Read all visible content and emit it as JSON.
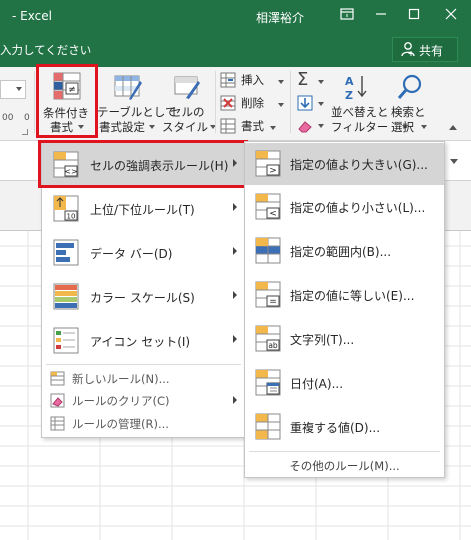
{
  "titlebar": {
    "app": "-  Excel",
    "user": "相澤裕介"
  },
  "tellme": {
    "text": "入力してください",
    "share": "共有"
  },
  "ribbon": {
    "num_decimal_1": "00",
    "num_decimal_2": "0",
    "conditional_format": {
      "line1": "条件付き",
      "line2": "書式"
    },
    "table_format": {
      "line1": "テーブルとして",
      "line2": "書式設定"
    },
    "cell_style": {
      "line1": "セルの",
      "line2": "スタイル"
    },
    "insert": "挿入",
    "delete": "削除",
    "format": "書式",
    "sort_filter": {
      "line1": "並べ替えと",
      "line2": "フィルター"
    },
    "find_select": {
      "line1": "検索と",
      "line2": "選択"
    }
  },
  "main_menu": {
    "items": [
      {
        "label": "セルの強調表示ルール(H)",
        "icon": "highlight-rules-icon"
      },
      {
        "label": "上位/下位ルール(T)",
        "icon": "top-bottom-icon"
      },
      {
        "label": "データ バー(D)",
        "icon": "data-bars-icon"
      },
      {
        "label": "カラー スケール(S)",
        "icon": "color-scales-icon"
      },
      {
        "label": "アイコン セット(I)",
        "icon": "icon-sets-icon"
      }
    ],
    "small_items": [
      {
        "label": "新しいルール(N)...",
        "icon": "new-rule-icon"
      },
      {
        "label": "ルールのクリア(C)",
        "icon": "clear-rules-icon"
      },
      {
        "label": "ルールの管理(R)...",
        "icon": "manage-rules-icon"
      }
    ]
  },
  "sub_menu": {
    "items": [
      {
        "label": "指定の値より大きい(G)...",
        "icon": "greater-than-icon"
      },
      {
        "label": "指定の値より小さい(L)...",
        "icon": "less-than-icon"
      },
      {
        "label": "指定の範囲内(B)...",
        "icon": "between-icon"
      },
      {
        "label": "指定の値に等しい(E)...",
        "icon": "equal-to-icon"
      },
      {
        "label": "文字列(T)...",
        "icon": "text-contains-icon"
      },
      {
        "label": "日付(A)...",
        "icon": "date-occurring-icon"
      },
      {
        "label": "重複する値(D)...",
        "icon": "duplicate-values-icon"
      }
    ],
    "more": "その他のルール(M)..."
  },
  "colors": {
    "excel_green": "#217346",
    "highlight_red": "#e0141e",
    "hover_gray": "#d5d5d5"
  }
}
